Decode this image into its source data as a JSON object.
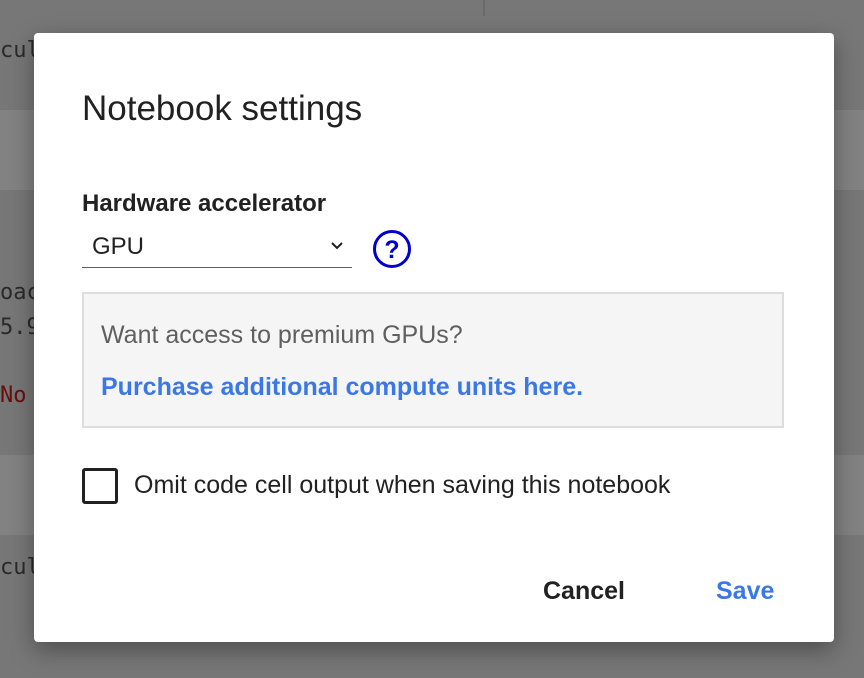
{
  "background": {
    "code_fragments": [
      "cul",
      "oac",
      "5.9",
      "No",
      "cul"
    ]
  },
  "dialog": {
    "title": "Notebook settings",
    "hardware_accelerator": {
      "label": "Hardware accelerator",
      "selected": "GPU",
      "help_icon": "question-circle-icon"
    },
    "promo": {
      "text": "Want access to premium GPUs?",
      "link": "Purchase additional compute units here."
    },
    "omit_output": {
      "label": "Omit code cell output when saving this notebook",
      "checked": false
    },
    "buttons": {
      "cancel": "Cancel",
      "save": "Save"
    }
  },
  "colors": {
    "accent": "#3b78e7",
    "help_icon": "#0000cc",
    "text_primary": "#212121",
    "promo_text": "#5f5f5f",
    "promo_bg": "#f5f5f5",
    "error_text": "#6a0d0d"
  }
}
